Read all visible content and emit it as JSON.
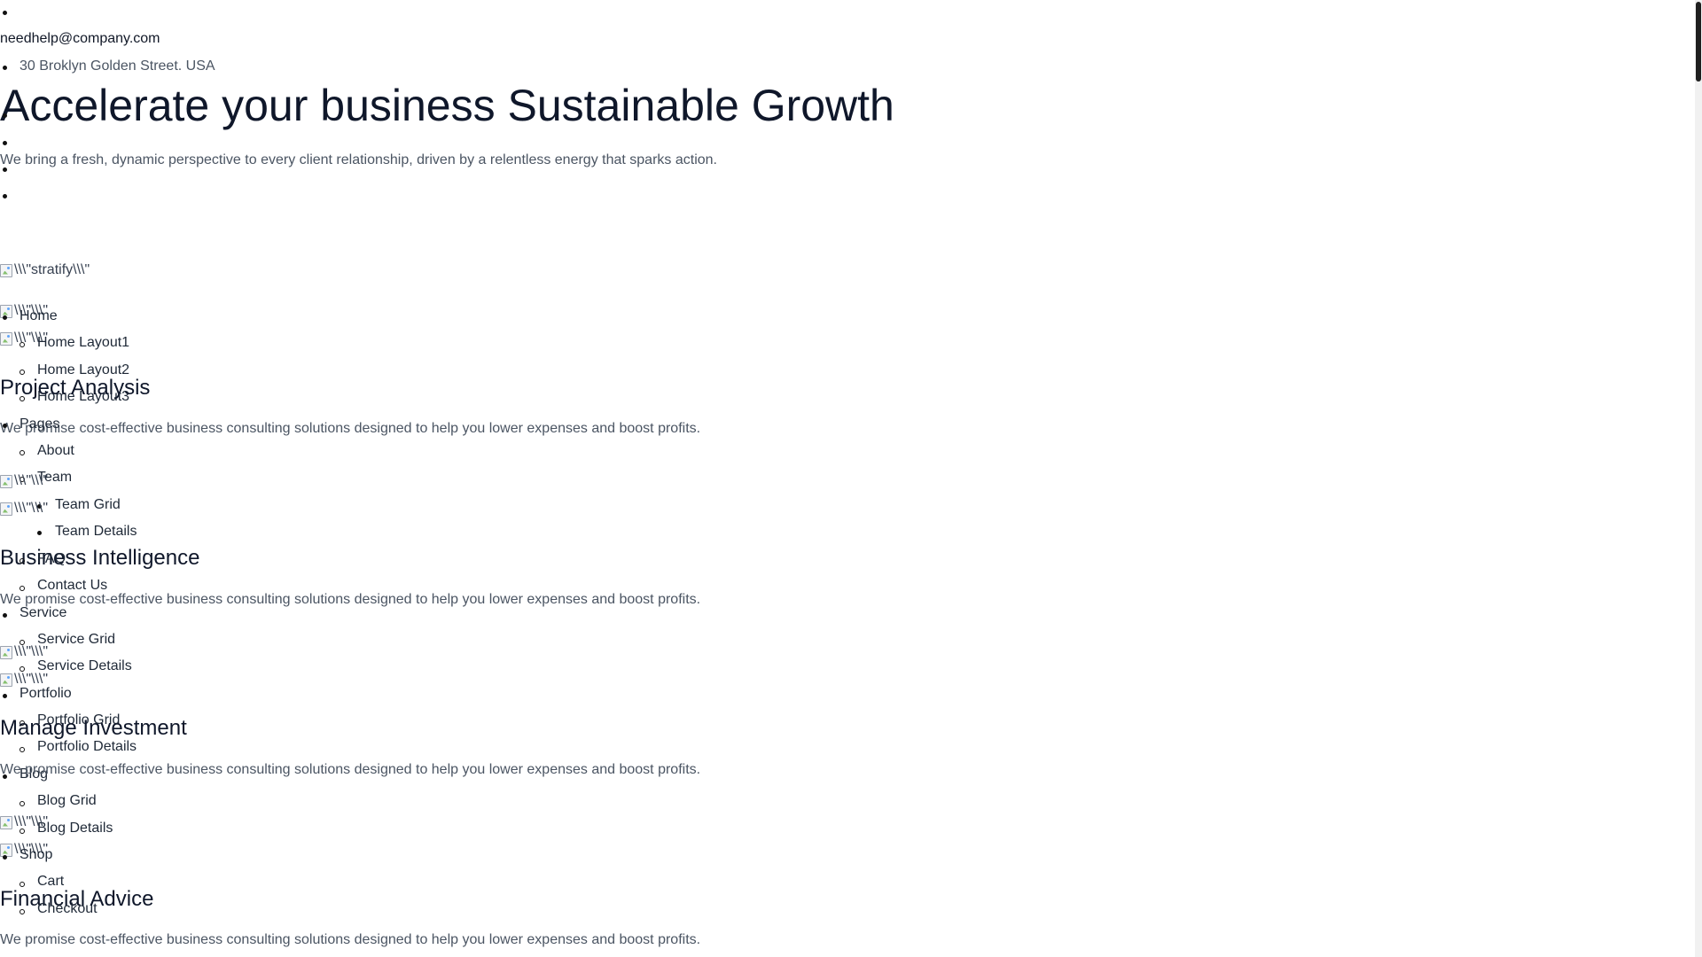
{
  "topbar": {
    "email": "needhelp@company.com",
    "address": "30 Broklyn Golden Street. USA"
  },
  "hero": {
    "title": "Accelerate your business Sustainable Growth",
    "subtitle": "We bring a fresh, dynamic perspective to every client relationship, driven by a relentless energy that sparks action."
  },
  "logo": {
    "alt": "\\\\\\\"stratify\\\\\\\""
  },
  "image_alt": "\\\\\\\"\\\\\\\"",
  "nav": {
    "home": "Home",
    "home_layout1": "Home Layout1",
    "home_layout2": "Home Layout2",
    "home_layout3": "Home Layout3",
    "pages": "Pages",
    "about": "About",
    "team": "Team",
    "team_grid": "Team Grid",
    "team_details": "Team Details",
    "faq": "FAQ",
    "contact": "Contact Us",
    "service": "Service",
    "service_grid": "Service Grid",
    "service_details": "Service Details",
    "portfolio": "Portfolio",
    "portfolio_grid": "Portfolio Grid",
    "portfolio_details": "Portfolio Details",
    "blog": "Blog",
    "blog_grid": "Blog Grid",
    "blog_details": "Blog Details",
    "shop": "Shop",
    "cart": "Cart",
    "checkout": "Checkout"
  },
  "cards": [
    {
      "title": "Project Analysis",
      "text": "We promise cost-effective business consulting solutions designed to help you lower expenses and boost profits."
    },
    {
      "title": "Business Intelligence",
      "text": "We promise cost-effective business consulting solutions designed to help you lower expenses and boost profits."
    },
    {
      "title": "Manage Investment",
      "text": "We promise cost-effective business consulting solutions designed to help you lower expenses and boost profits."
    },
    {
      "title": "Financial Advice",
      "text": "We promise cost-effective business consulting solutions designed to help you lower expenses and boost profits."
    }
  ]
}
